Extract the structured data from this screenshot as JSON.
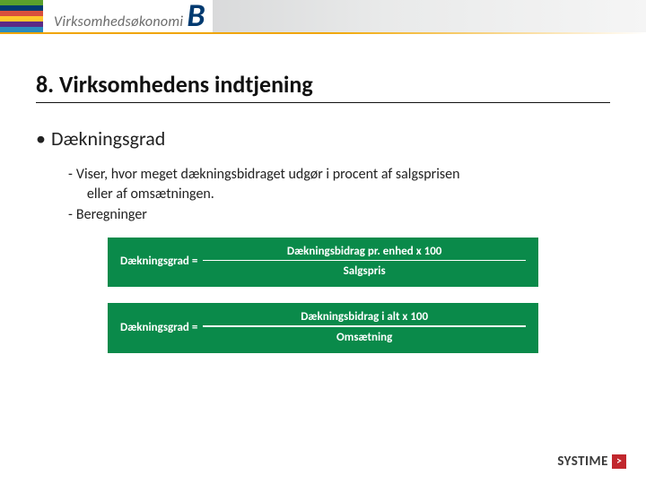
{
  "header": {
    "brand_text": "Virksomhedsøkonomi",
    "brand_letter": "B"
  },
  "title": "8. Virksomhedens indtjening",
  "main_bullet": "Dækningsgrad",
  "sub_items": {
    "item1_line1": "Viser, hvor meget dækningsbidraget udgør i procent af salgsprisen",
    "item1_line2": "eller af omsætningen.",
    "item2": "Beregninger"
  },
  "formulas": {
    "f1": {
      "left": "Dækningsgrad =",
      "numerator": "Dækningsbidrag pr. enhed x 100",
      "denominator": "Salgspris"
    },
    "f2": {
      "left": "Dækningsgrad =",
      "numerator": "Dækningsbidrag i alt x 100",
      "denominator": "Omsætning"
    }
  },
  "footer": {
    "logo_text": "SYSTIME",
    "logo_symbol": ">"
  }
}
